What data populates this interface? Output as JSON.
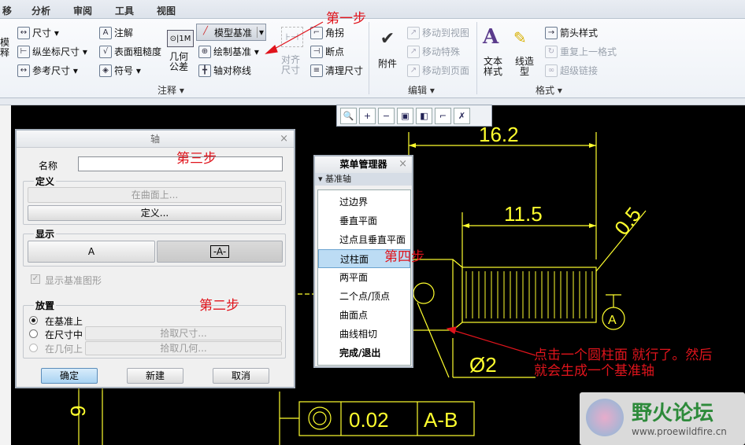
{
  "tabs": [
    "移",
    "分析",
    "审阅",
    "工具",
    "视图"
  ],
  "ribbon": {
    "dim_group": {
      "dimension": "尺寸",
      "ordinate_dimension": "纵坐标尺寸",
      "reference_dimension": "参考尺寸",
      "note": "注解",
      "surface_finish": "表面粗糙度",
      "symbol": "符号",
      "geo_tol_line1": "几何",
      "geo_tol_line2": "公差",
      "model_datum": "模型基准",
      "sketch_datum": "绘制基准",
      "axis_symmetry": "轴对称线",
      "align_line1": "对齐",
      "align_line2": "尺寸",
      "jog": "角拐",
      "breakpoint": "断点",
      "cleanup_dimension": "清理尺寸",
      "left_line1": "模",
      "left_line2": "释",
      "group_label": "注释"
    },
    "edit_group": {
      "attach": "附件",
      "move_to_view": "移动到视图",
      "move_special": "移动特殊",
      "move_to_page": "移动到页面",
      "group_label": "编辑"
    },
    "format_group": {
      "text_style_line1": "文本",
      "text_style_line2": "样式",
      "line_style_line1": "线造",
      "line_style_line2": "型",
      "arrow_style": "箭头样式",
      "repeat_format": "重复上一格式",
      "hyperlink": "超级链接",
      "group_label": "格式"
    }
  },
  "axis_dialog": {
    "title": "轴",
    "name_label": "名称",
    "name_value": "",
    "definition_section": "定义",
    "on_surface_button": "在曲面上...",
    "define_button": "定义...",
    "display_section": "显示",
    "display_a": "A",
    "display_boxed_a": "-A-",
    "show_datum_checkbox": "显示基准图形",
    "placement_section": "放置",
    "place_on_datum": "在基准上",
    "place_in_dimension": "在尺寸中",
    "place_on_geometry": "在几何上",
    "pick_dimension_button": "拾取尺寸...",
    "pick_geometry_button": "拾取几何...",
    "ok_button": "确定",
    "new_button": "新建",
    "cancel_button": "取消"
  },
  "menu_manager": {
    "title": "菜单管理器",
    "subtitle": "基准轴",
    "items": [
      "过边界",
      "垂直平面",
      "过点且垂直平面",
      "过柱面",
      "两平面",
      "二个点/顶点",
      "曲面点",
      "曲线相切",
      "完成/退出"
    ],
    "selected_index": 3
  },
  "drawing": {
    "dim_16_2": "16.2",
    "dim_11_5": "11.5",
    "dim_0_5": "0.5",
    "diameter": "Ø2",
    "datum_a": "A",
    "tolerance": "0.02",
    "datum_ref": "A-B",
    "left_number": "9"
  },
  "annotations": {
    "step1": "第一步",
    "step2": "第二步",
    "step3": "第三步",
    "step4": "第四步",
    "note_line1": "点击一个圆柱面 就行了。然后",
    "note_line2": "就会生成一个基准轴"
  },
  "watermark": {
    "title": "野火论坛",
    "url": "www.proewildfire.cn"
  },
  "colors": {
    "drawing_yellow": "#ffff2e",
    "annotation_red": "#e0141c",
    "ribbon_bg": "#eef2f7"
  }
}
